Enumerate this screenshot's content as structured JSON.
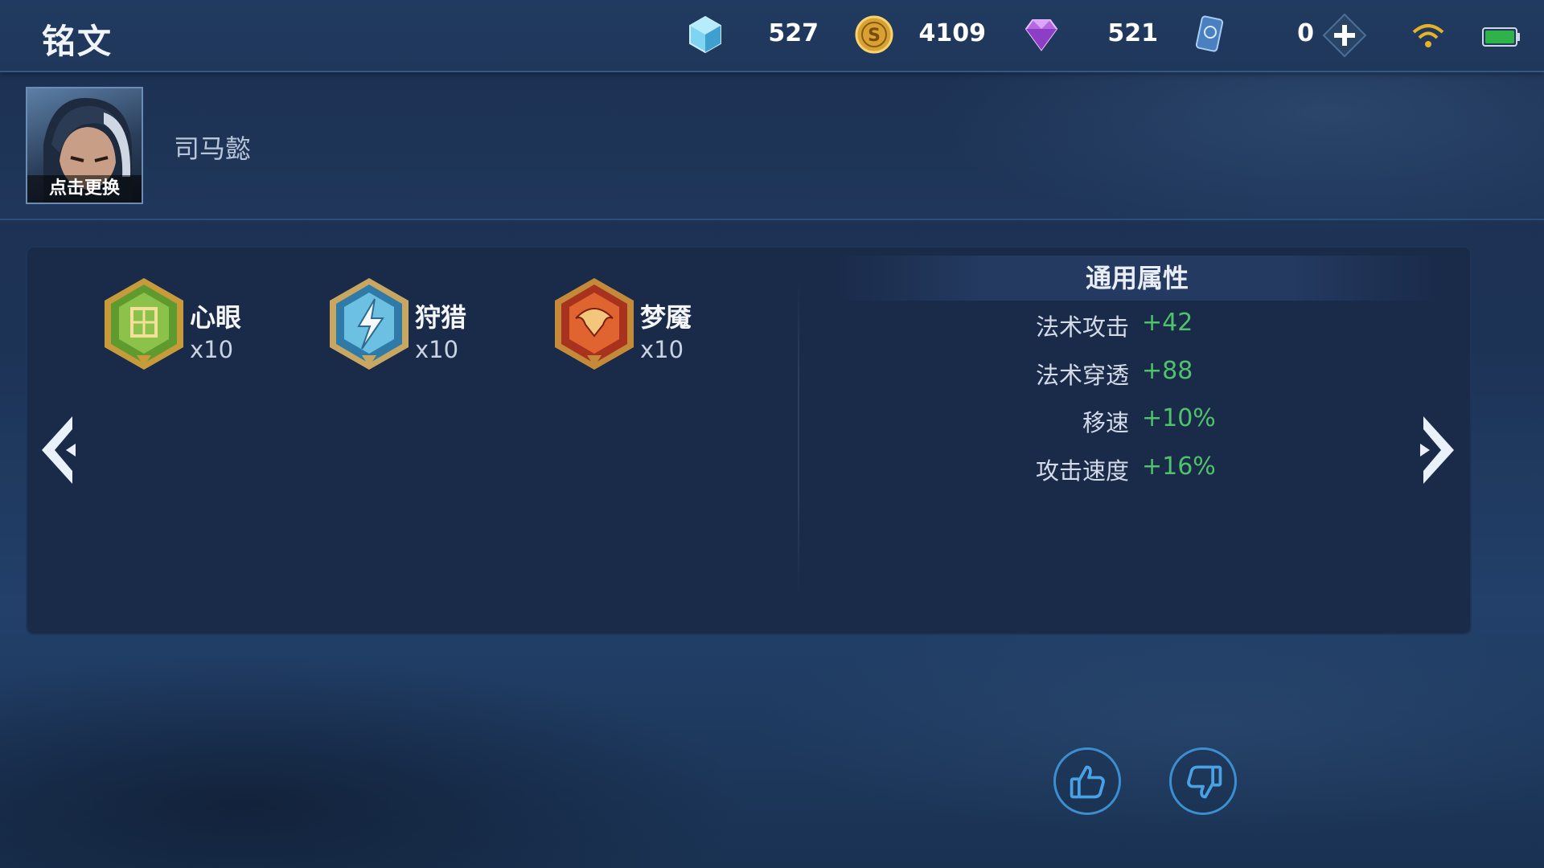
{
  "header": {
    "title": "铭文",
    "currencies": [
      {
        "name": "crystal-icon",
        "value": "527"
      },
      {
        "name": "gold-coin-icon",
        "value": "4109"
      },
      {
        "name": "gem-icon",
        "value": "521"
      },
      {
        "name": "ticket-icon",
        "value": "0"
      }
    ],
    "plus_icon": "plus-icon",
    "wifi_icon": "wifi-icon",
    "battery_icon": "battery-icon",
    "battery_color": "#2fb24a"
  },
  "hero": {
    "avatar_caption": "点击更换",
    "name": "司马懿"
  },
  "runes": [
    {
      "name": "心眼",
      "count": "x10",
      "color": "#6da83a"
    },
    {
      "name": "狩猎",
      "count": "x10",
      "color": "#4aa0c8"
    },
    {
      "name": "梦魇",
      "count": "x10",
      "color": "#d2502c"
    }
  ],
  "attributes": {
    "title": "通用属性",
    "rows": [
      {
        "label": "法术攻击",
        "value": "+42"
      },
      {
        "label": "法术穿透",
        "value": "+88"
      },
      {
        "label": "移速",
        "value": "+10%"
      },
      {
        "label": "攻击速度",
        "value": "+16%"
      }
    ],
    "value_color": "#4fc36b"
  },
  "nav": {
    "prev_icon": "chevron-left-icon",
    "next_icon": "chevron-right-icon"
  },
  "vote": {
    "like_icon": "thumbs-up-icon",
    "dislike_icon": "thumbs-down-icon"
  }
}
